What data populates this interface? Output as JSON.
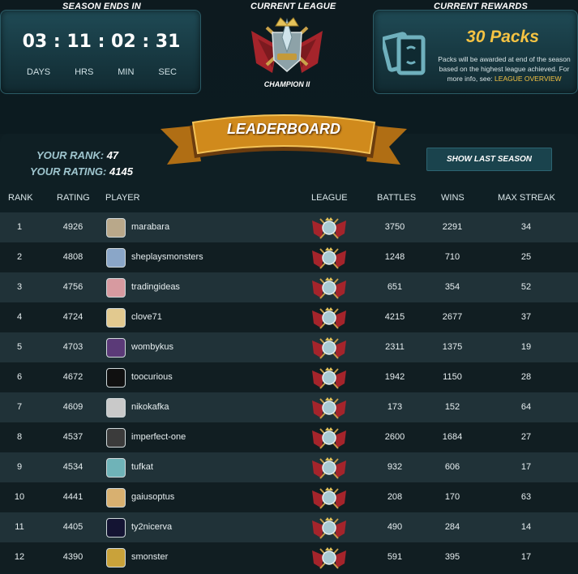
{
  "season": {
    "header": "SEASON ENDS IN",
    "timer": "03 : 11 : 02 : 31",
    "labels": [
      "DAYS",
      "HRS",
      "MIN",
      "SEC"
    ]
  },
  "league": {
    "header": "CURRENT LEAGUE",
    "name": "CHAMPION II",
    "icon": "champion-league-icon"
  },
  "rewards": {
    "header": "CURRENT REWARDS",
    "packs": "30 Packs",
    "desc": "Packs will be awarded at end of the season based on the highest league achieved. For more info, see:",
    "link": "LEAGUE OVERVIEW",
    "icon": "card-packs-icon"
  },
  "leaderboard": {
    "title": "LEADERBOARD",
    "your_rank_label": "YOUR RANK:",
    "your_rank": "47",
    "your_rating_label": "YOUR RATING:",
    "your_rating": "4145",
    "show_last_season": "SHOW LAST SEASON",
    "columns": [
      "RANK",
      "RATING",
      "PLAYER",
      "LEAGUE",
      "BATTLES",
      "WINS",
      "MAX STREAK"
    ],
    "rows": [
      {
        "rank": "1",
        "rating": "4926",
        "player": "marabara",
        "battles": "3750",
        "wins": "2291",
        "streak": "34",
        "avatar_color": "#b9a88a"
      },
      {
        "rank": "2",
        "rating": "4808",
        "player": "sheplaysmonsters",
        "battles": "1248",
        "wins": "710",
        "streak": "25",
        "avatar_color": "#8aa6c8"
      },
      {
        "rank": "3",
        "rating": "4756",
        "player": "tradingideas",
        "battles": "651",
        "wins": "354",
        "streak": "52",
        "avatar_color": "#d79aa0"
      },
      {
        "rank": "4",
        "rating": "4724",
        "player": "clove71",
        "battles": "4215",
        "wins": "2677",
        "streak": "37",
        "avatar_color": "#e2c98f"
      },
      {
        "rank": "5",
        "rating": "4703",
        "player": "wombykus",
        "battles": "2311",
        "wins": "1375",
        "streak": "19",
        "avatar_color": "#5b3a78"
      },
      {
        "rank": "6",
        "rating": "4672",
        "player": "toocurious",
        "battles": "1942",
        "wins": "1150",
        "streak": "28",
        "avatar_color": "#101010"
      },
      {
        "rank": "7",
        "rating": "4609",
        "player": "nikokafka",
        "battles": "173",
        "wins": "152",
        "streak": "64",
        "avatar_color": "#c9c9c9"
      },
      {
        "rank": "8",
        "rating": "4537",
        "player": "imperfect-one",
        "battles": "2600",
        "wins": "1684",
        "streak": "27",
        "avatar_color": "#3b3b3b"
      },
      {
        "rank": "9",
        "rating": "4534",
        "player": "tufkat",
        "battles": "932",
        "wins": "606",
        "streak": "17",
        "avatar_color": "#6fb3b8"
      },
      {
        "rank": "10",
        "rating": "4441",
        "player": "gaiusoptus",
        "battles": "208",
        "wins": "170",
        "streak": "63",
        "avatar_color": "#d8b070"
      },
      {
        "rank": "11",
        "rating": "4405",
        "player": "ty2nicerva",
        "battles": "490",
        "wins": "284",
        "streak": "14",
        "avatar_color": "#141433"
      },
      {
        "rank": "12",
        "rating": "4390",
        "player": "smonster",
        "battles": "591",
        "wins": "395",
        "streak": "17",
        "avatar_color": "#c9a23a"
      }
    ]
  },
  "colors": {
    "accent_gold": "#f5c343",
    "row_odd": "#203238",
    "row_even": "#111e22"
  }
}
